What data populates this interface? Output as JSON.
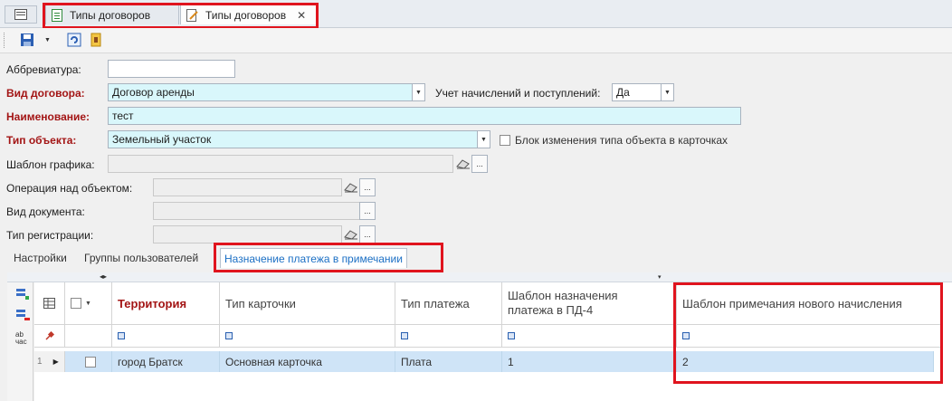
{
  "tabs": [
    {
      "label": "Типы договоров",
      "icon": "document-icon"
    },
    {
      "label": "Типы договоров",
      "icon": "edit-document-icon",
      "close": "✕"
    }
  ],
  "toolbar": {
    "save_icon": "save-icon",
    "refresh_icon": "refresh-icon",
    "exit_icon": "exit-icon"
  },
  "form": {
    "abbreviation": {
      "label": "Аббревиатура:",
      "value": ""
    },
    "contract_kind": {
      "label": "Вид договора:",
      "value": "Договор аренды"
    },
    "accounting": {
      "label": "Учет начислений и поступлений:",
      "value": "Да"
    },
    "name": {
      "label": "Наименование:",
      "value": "тест"
    },
    "object_type": {
      "label": "Тип объекта:",
      "value": "Земельный участок"
    },
    "block_change": {
      "label": "Блок изменения типа объекта в карточках",
      "checked": false
    },
    "schedule_template": {
      "label": "Шаблон графика:",
      "value": ""
    },
    "object_operation": {
      "label": "Операция над объектом:",
      "value": ""
    },
    "document_kind": {
      "label": "Вид документа:",
      "value": ""
    },
    "registration_type": {
      "label": "Тип регистрации:",
      "value": ""
    }
  },
  "inner_tabs": [
    "Настройки",
    "Группы пользователей",
    "Назначение платежа в примечании"
  ],
  "grid": {
    "columns": [
      "Территория",
      "Тип карточки",
      "Тип платежа",
      "Шаблон назначения платежа в ПД-4",
      "Шаблон примечания нового начисления"
    ],
    "rows": [
      {
        "num": "1",
        "cells": [
          "город Братск",
          "Основная карточка",
          "Плата",
          "1",
          "2"
        ]
      }
    ],
    "side_icons": [
      "add-row-icon",
      "delete-row-icon",
      "spellcheck-icon"
    ],
    "side_label": "ab\nчас"
  }
}
